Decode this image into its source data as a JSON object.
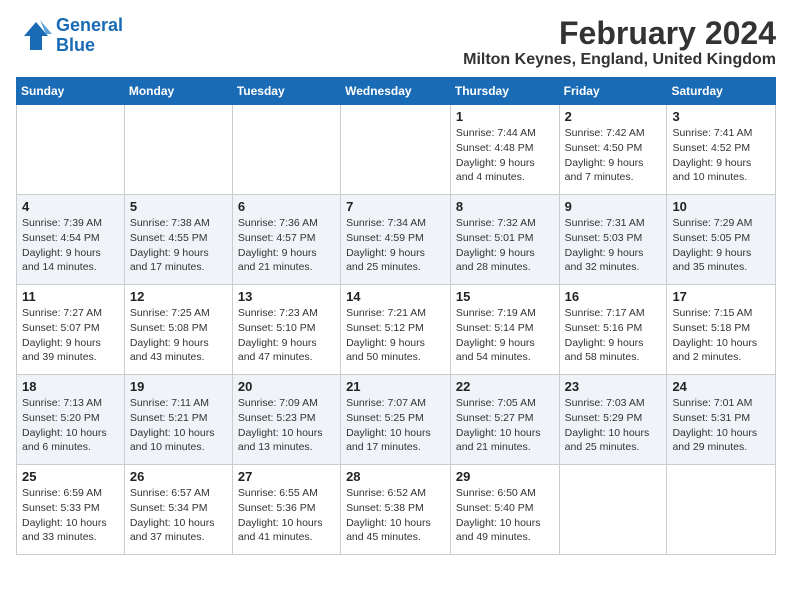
{
  "logo": {
    "line1": "General",
    "line2": "Blue"
  },
  "title": "February 2024",
  "location": "Milton Keynes, England, United Kingdom",
  "days_of_week": [
    "Sunday",
    "Monday",
    "Tuesday",
    "Wednesday",
    "Thursday",
    "Friday",
    "Saturday"
  ],
  "weeks": [
    [
      {
        "day": "",
        "info": ""
      },
      {
        "day": "",
        "info": ""
      },
      {
        "day": "",
        "info": ""
      },
      {
        "day": "",
        "info": ""
      },
      {
        "day": "1",
        "info": "Sunrise: 7:44 AM\nSunset: 4:48 PM\nDaylight: 9 hours\nand 4 minutes."
      },
      {
        "day": "2",
        "info": "Sunrise: 7:42 AM\nSunset: 4:50 PM\nDaylight: 9 hours\nand 7 minutes."
      },
      {
        "day": "3",
        "info": "Sunrise: 7:41 AM\nSunset: 4:52 PM\nDaylight: 9 hours\nand 10 minutes."
      }
    ],
    [
      {
        "day": "4",
        "info": "Sunrise: 7:39 AM\nSunset: 4:54 PM\nDaylight: 9 hours\nand 14 minutes."
      },
      {
        "day": "5",
        "info": "Sunrise: 7:38 AM\nSunset: 4:55 PM\nDaylight: 9 hours\nand 17 minutes."
      },
      {
        "day": "6",
        "info": "Sunrise: 7:36 AM\nSunset: 4:57 PM\nDaylight: 9 hours\nand 21 minutes."
      },
      {
        "day": "7",
        "info": "Sunrise: 7:34 AM\nSunset: 4:59 PM\nDaylight: 9 hours\nand 25 minutes."
      },
      {
        "day": "8",
        "info": "Sunrise: 7:32 AM\nSunset: 5:01 PM\nDaylight: 9 hours\nand 28 minutes."
      },
      {
        "day": "9",
        "info": "Sunrise: 7:31 AM\nSunset: 5:03 PM\nDaylight: 9 hours\nand 32 minutes."
      },
      {
        "day": "10",
        "info": "Sunrise: 7:29 AM\nSunset: 5:05 PM\nDaylight: 9 hours\nand 35 minutes."
      }
    ],
    [
      {
        "day": "11",
        "info": "Sunrise: 7:27 AM\nSunset: 5:07 PM\nDaylight: 9 hours\nand 39 minutes."
      },
      {
        "day": "12",
        "info": "Sunrise: 7:25 AM\nSunset: 5:08 PM\nDaylight: 9 hours\nand 43 minutes."
      },
      {
        "day": "13",
        "info": "Sunrise: 7:23 AM\nSunset: 5:10 PM\nDaylight: 9 hours\nand 47 minutes."
      },
      {
        "day": "14",
        "info": "Sunrise: 7:21 AM\nSunset: 5:12 PM\nDaylight: 9 hours\nand 50 minutes."
      },
      {
        "day": "15",
        "info": "Sunrise: 7:19 AM\nSunset: 5:14 PM\nDaylight: 9 hours\nand 54 minutes."
      },
      {
        "day": "16",
        "info": "Sunrise: 7:17 AM\nSunset: 5:16 PM\nDaylight: 9 hours\nand 58 minutes."
      },
      {
        "day": "17",
        "info": "Sunrise: 7:15 AM\nSunset: 5:18 PM\nDaylight: 10 hours\nand 2 minutes."
      }
    ],
    [
      {
        "day": "18",
        "info": "Sunrise: 7:13 AM\nSunset: 5:20 PM\nDaylight: 10 hours\nand 6 minutes."
      },
      {
        "day": "19",
        "info": "Sunrise: 7:11 AM\nSunset: 5:21 PM\nDaylight: 10 hours\nand 10 minutes."
      },
      {
        "day": "20",
        "info": "Sunrise: 7:09 AM\nSunset: 5:23 PM\nDaylight: 10 hours\nand 13 minutes."
      },
      {
        "day": "21",
        "info": "Sunrise: 7:07 AM\nSunset: 5:25 PM\nDaylight: 10 hours\nand 17 minutes."
      },
      {
        "day": "22",
        "info": "Sunrise: 7:05 AM\nSunset: 5:27 PM\nDaylight: 10 hours\nand 21 minutes."
      },
      {
        "day": "23",
        "info": "Sunrise: 7:03 AM\nSunset: 5:29 PM\nDaylight: 10 hours\nand 25 minutes."
      },
      {
        "day": "24",
        "info": "Sunrise: 7:01 AM\nSunset: 5:31 PM\nDaylight: 10 hours\nand 29 minutes."
      }
    ],
    [
      {
        "day": "25",
        "info": "Sunrise: 6:59 AM\nSunset: 5:33 PM\nDaylight: 10 hours\nand 33 minutes."
      },
      {
        "day": "26",
        "info": "Sunrise: 6:57 AM\nSunset: 5:34 PM\nDaylight: 10 hours\nand 37 minutes."
      },
      {
        "day": "27",
        "info": "Sunrise: 6:55 AM\nSunset: 5:36 PM\nDaylight: 10 hours\nand 41 minutes."
      },
      {
        "day": "28",
        "info": "Sunrise: 6:52 AM\nSunset: 5:38 PM\nDaylight: 10 hours\nand 45 minutes."
      },
      {
        "day": "29",
        "info": "Sunrise: 6:50 AM\nSunset: 5:40 PM\nDaylight: 10 hours\nand 49 minutes."
      },
      {
        "day": "",
        "info": ""
      },
      {
        "day": "",
        "info": ""
      }
    ]
  ]
}
